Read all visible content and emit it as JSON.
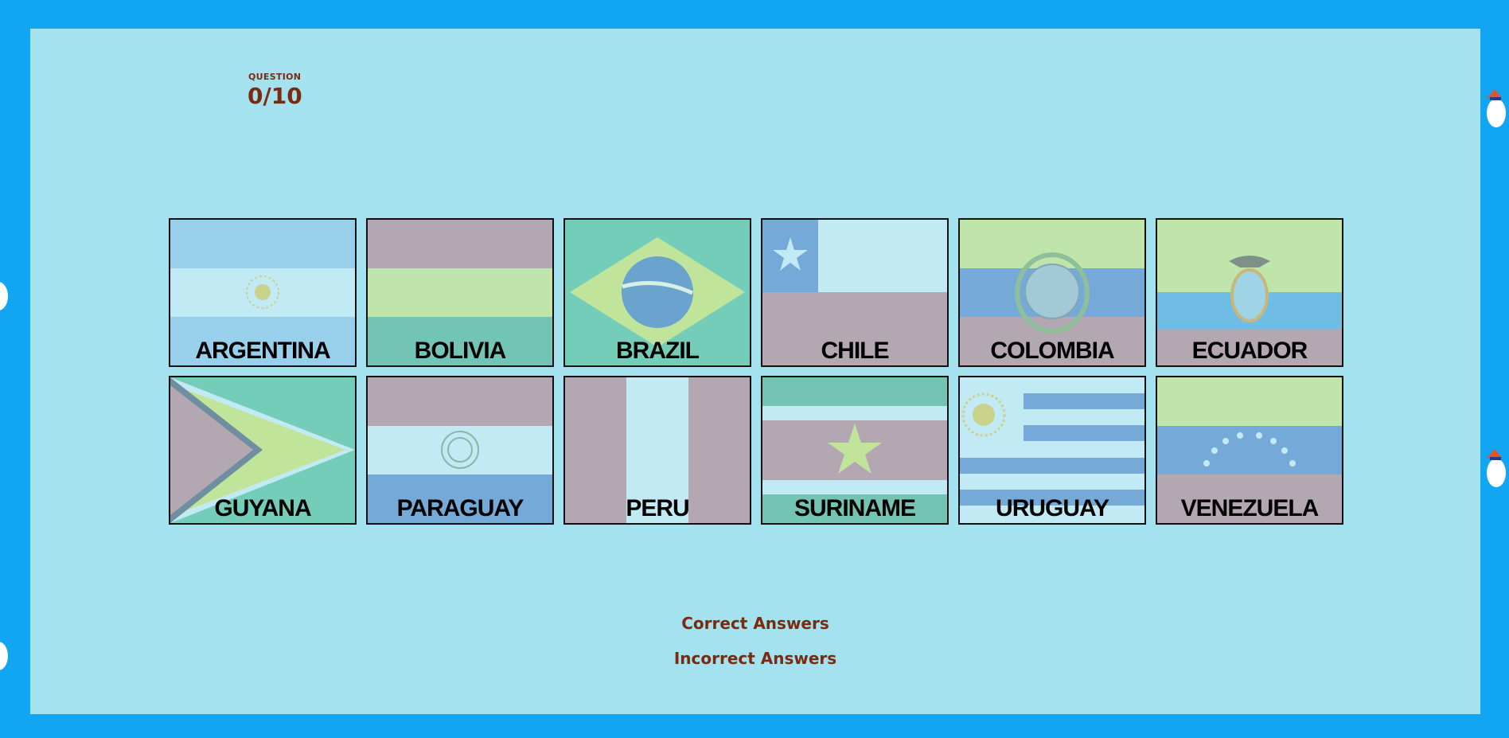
{
  "question": {
    "label": "QUESTION",
    "progress": "0/10"
  },
  "flags": [
    {
      "name": "ARGENTINA"
    },
    {
      "name": "BOLIVIA"
    },
    {
      "name": "BRAZIL"
    },
    {
      "name": "CHILE"
    },
    {
      "name": "COLOMBIA"
    },
    {
      "name": "ECUADOR"
    },
    {
      "name": "GUYANA"
    },
    {
      "name": "PARAGUAY"
    },
    {
      "name": "PERU"
    },
    {
      "name": "SURINAME"
    },
    {
      "name": "URUGUAY"
    },
    {
      "name": "VENEZUELA"
    }
  ],
  "results": {
    "correct_label": "Correct Answers",
    "incorrect_label": "Incorrect Answers"
  },
  "colors": {
    "background": "#12a5f1",
    "panel": "#a5e2f0",
    "text_accent": "#7b2a12"
  }
}
